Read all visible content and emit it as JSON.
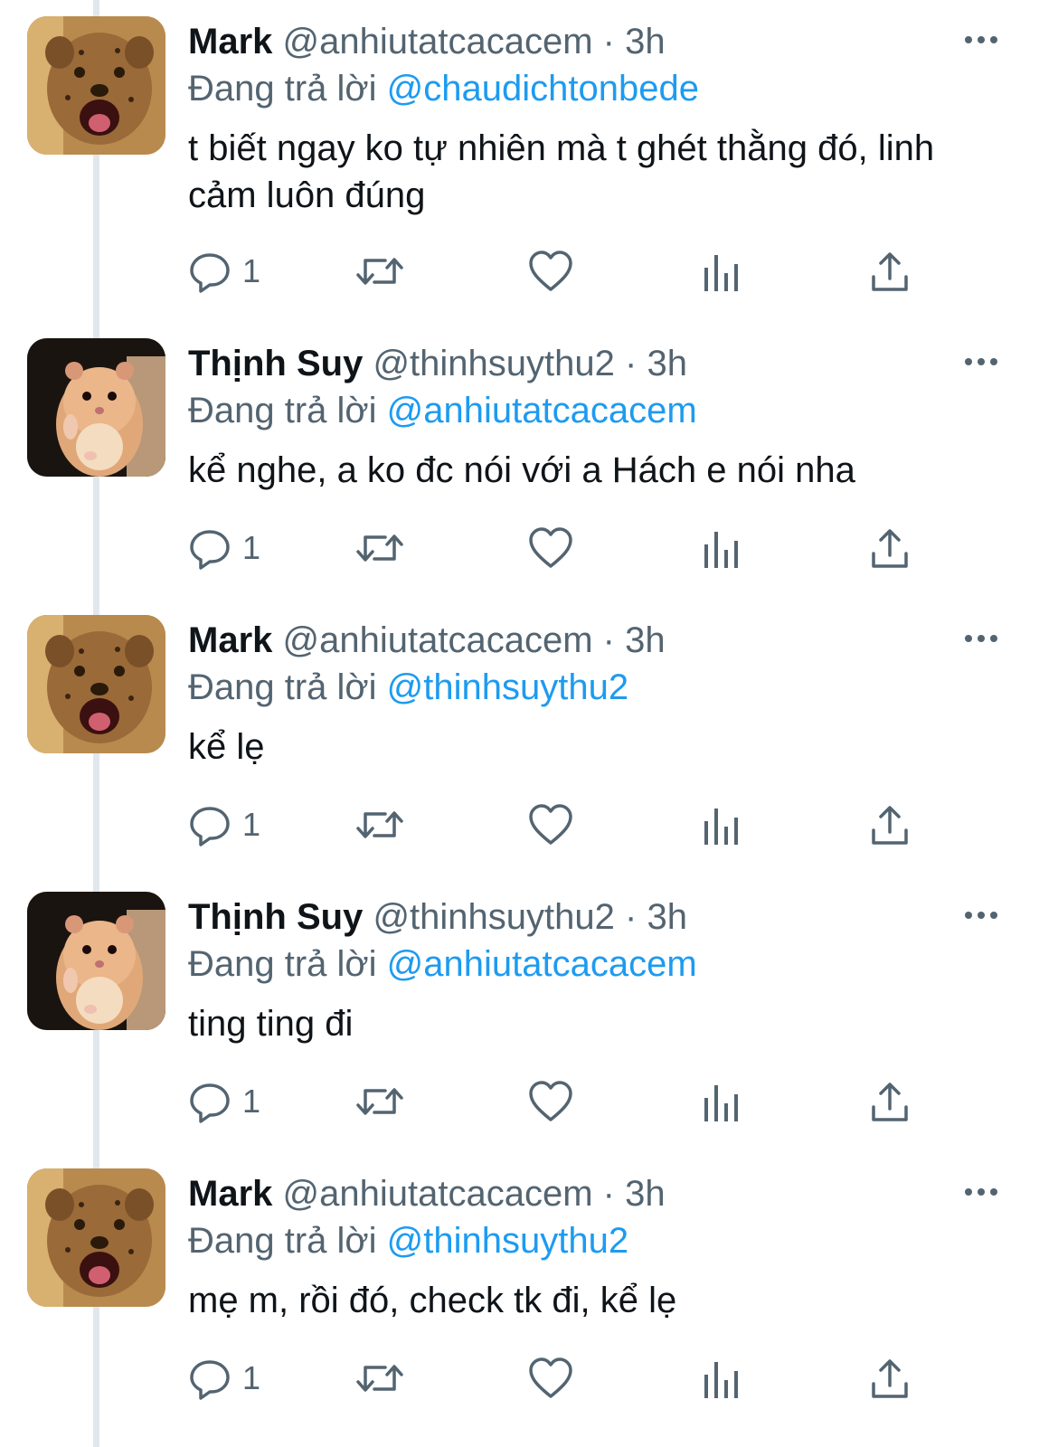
{
  "colors": {
    "accent": "#1d9bf0",
    "secondary_text": "#536471",
    "thread_line": "#e1e8ed"
  },
  "tweets": [
    {
      "avatar": "cheetah-cub",
      "name": "Mark",
      "handle": "@anhiutatcacacem",
      "time": "· 3h",
      "replying_label": "Đang trả lời",
      "replying_to": "@chaudichtonbede",
      "text": "t biết ngay ko tự nhiên mà t ghét thằng đó, linh cảm luôn đúng",
      "reply_count": "1"
    },
    {
      "avatar": "hamster",
      "name": "Thịnh Suy",
      "handle": "@thinhsuythu2",
      "time": "· 3h",
      "replying_label": "Đang trả lời",
      "replying_to": "@anhiutatcacacem",
      "text": "kể nghe, a ko đc nói với a Hách e nói nha",
      "reply_count": "1"
    },
    {
      "avatar": "cheetah-cub",
      "name": "Mark",
      "handle": "@anhiutatcacacem",
      "time": "· 3h",
      "replying_label": "Đang trả lời",
      "replying_to": "@thinhsuythu2",
      "text": "kể lẹ",
      "reply_count": "1"
    },
    {
      "avatar": "hamster",
      "name": "Thịnh Suy",
      "handle": "@thinhsuythu2",
      "time": "· 3h",
      "replying_label": "Đang trả lời",
      "replying_to": "@anhiutatcacacem",
      "text": "ting ting đi",
      "reply_count": "1"
    },
    {
      "avatar": "cheetah-cub",
      "name": "Mark",
      "handle": "@anhiutatcacacem",
      "time": "· 3h",
      "replying_label": "Đang trả lời",
      "replying_to": "@thinhsuythu2",
      "text": "mẹ m, rồi đó, check tk đi, kể lẹ",
      "reply_count": "1"
    }
  ]
}
